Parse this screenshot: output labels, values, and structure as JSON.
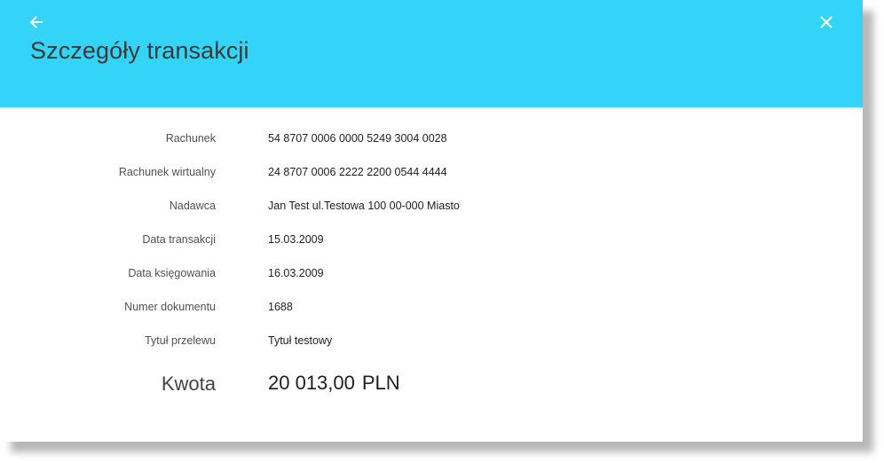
{
  "header": {
    "title": "Szczegóły transakcji",
    "background_color": "#33d4f8",
    "back_icon": "arrow-left-icon",
    "close_icon": "close-icon"
  },
  "details": [
    {
      "label": "Rachunek",
      "value": "54 8707 0006 0000 5249 3004 0028"
    },
    {
      "label": "Rachunek wirtualny",
      "value": "24 8707 0006 2222 2200 0544 4444"
    },
    {
      "label": "Nadawca",
      "value": "Jan Test ul.Testowa 100 00-000 Miasto"
    },
    {
      "label": "Data transakcji",
      "value": "15.03.2009"
    },
    {
      "label": "Data księgowania",
      "value": "16.03.2009"
    },
    {
      "label": "Numer dokumentu",
      "value": "1688"
    },
    {
      "label": "Tytuł przelewu",
      "value": "Tytuł testowy"
    }
  ],
  "amount": {
    "label": "Kwota",
    "value": "20 013,00",
    "currency": "PLN"
  }
}
